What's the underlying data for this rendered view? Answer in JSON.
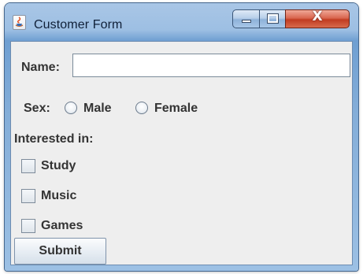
{
  "window": {
    "title": "Customer Form",
    "app_icon": "java-icon",
    "controls": {
      "minimize_icon": "minimize-icon",
      "maximize_icon": "maximize-icon",
      "close_label": "X"
    }
  },
  "form": {
    "name": {
      "label": "Name:",
      "value": ""
    },
    "sex": {
      "label": "Sex:",
      "options": [
        "Male",
        "Female"
      ],
      "selected": null
    },
    "interests": {
      "label": "Interested in:",
      "items": [
        {
          "label": "Study",
          "checked": false
        },
        {
          "label": "Music",
          "checked": false
        },
        {
          "label": "Games",
          "checked": false
        }
      ]
    },
    "submit_label": "Submit"
  }
}
